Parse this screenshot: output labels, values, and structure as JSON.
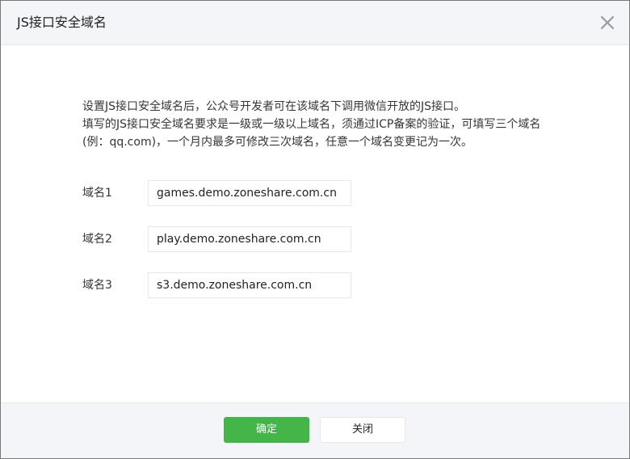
{
  "dialog": {
    "title": "JS接口安全域名",
    "close_icon": "close-icon"
  },
  "description": {
    "line1": "设置JS接口安全域名后，公众号开发者可在该域名下调用微信开放的JS接口。",
    "line2": "填写的JS接口安全域名要求是一级或一级以上域名，须通过ICP备案的验证，可填写三个域名",
    "line3": "(例：qq.com)，一个月内最多可修改三次域名，任意一个域名变更记为一次。"
  },
  "domains": [
    {
      "label": "域名1",
      "value": "games.demo.zoneshare.com.cn"
    },
    {
      "label": "域名2",
      "value": "play.demo.zoneshare.com.cn"
    },
    {
      "label": "域名3",
      "value": "s3.demo.zoneshare.com.cn"
    }
  ],
  "footer": {
    "confirm_label": "确定",
    "close_label": "关闭"
  },
  "colors": {
    "primary": "#44b549",
    "header_bg": "#f4f5f9",
    "border": "#e4e8eb"
  }
}
